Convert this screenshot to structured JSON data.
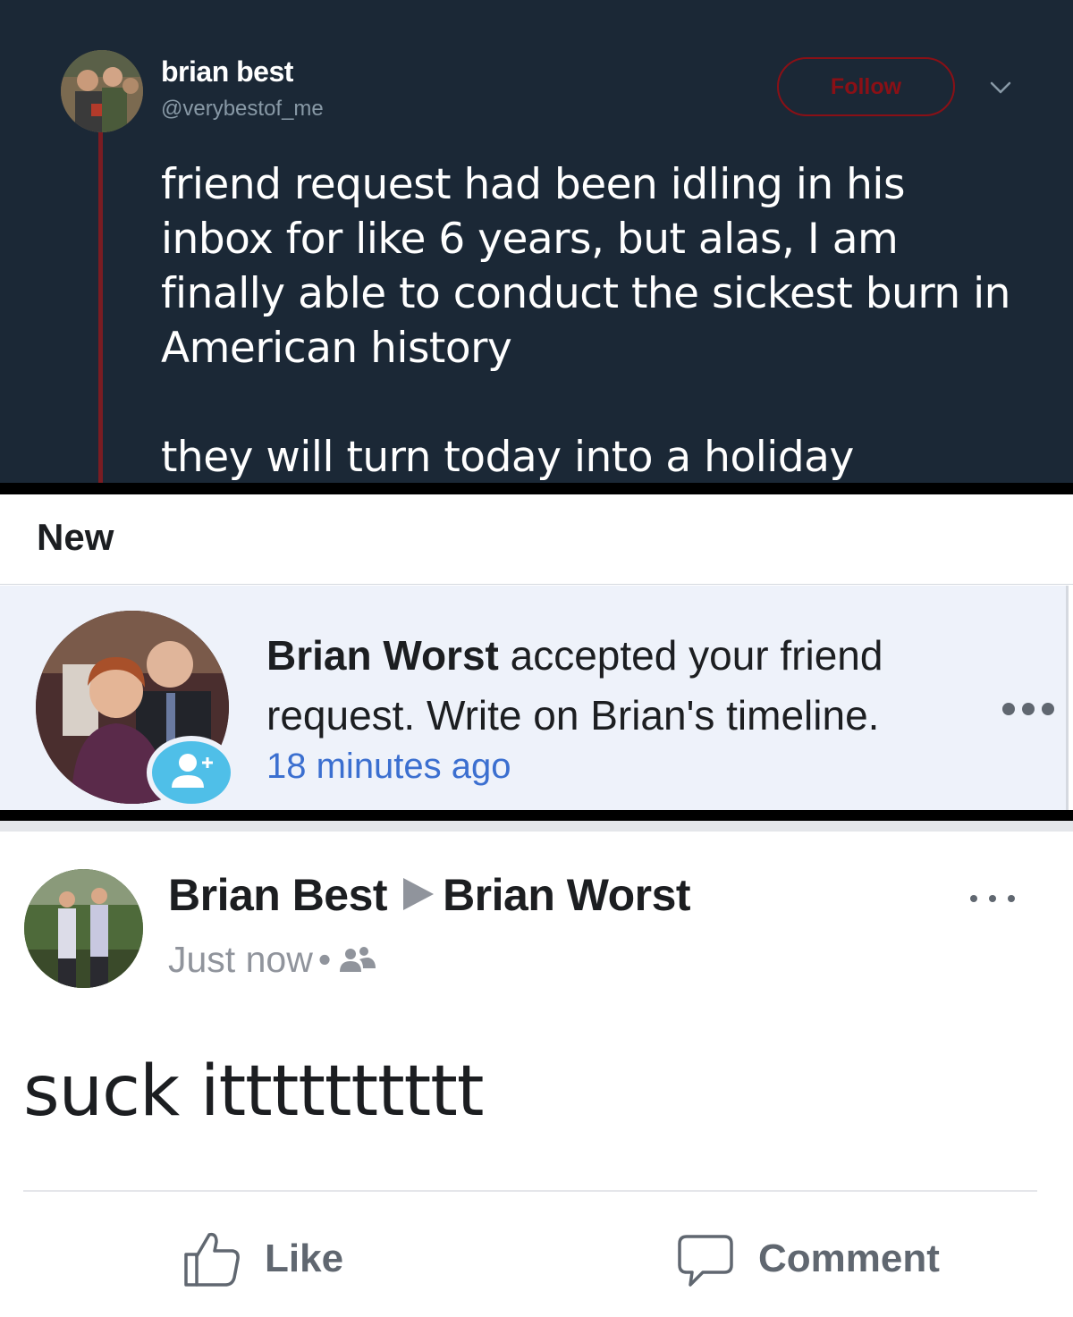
{
  "tweet": {
    "display_name": "brian best",
    "handle": "@verybestof_me",
    "follow_label": "Follow",
    "text": "friend request had been idling in his\ninbox for like 6 years, but alas, I am\nfinally able to conduct the sickest burn in\nAmerican history\n\nthey will turn today into a holiday",
    "accent_color": "#8a1016",
    "background_color": "#1b2836"
  },
  "notifications": {
    "section_title": "New",
    "item": {
      "actor_name": "Brian Worst",
      "message_rest": " accepted your friend request. Write on Brian's timeline.",
      "time": "18 minutes ago",
      "badge_icon": "add-friend-icon",
      "background_color": "#eef2fa"
    }
  },
  "post": {
    "author": "Brian Best",
    "target": "Brian Worst",
    "time": "Just now",
    "separator": "•",
    "audience_icon": "friends-icon",
    "body": "suck itttttttttt",
    "actions": {
      "like_label": "Like",
      "comment_label": "Comment"
    }
  }
}
